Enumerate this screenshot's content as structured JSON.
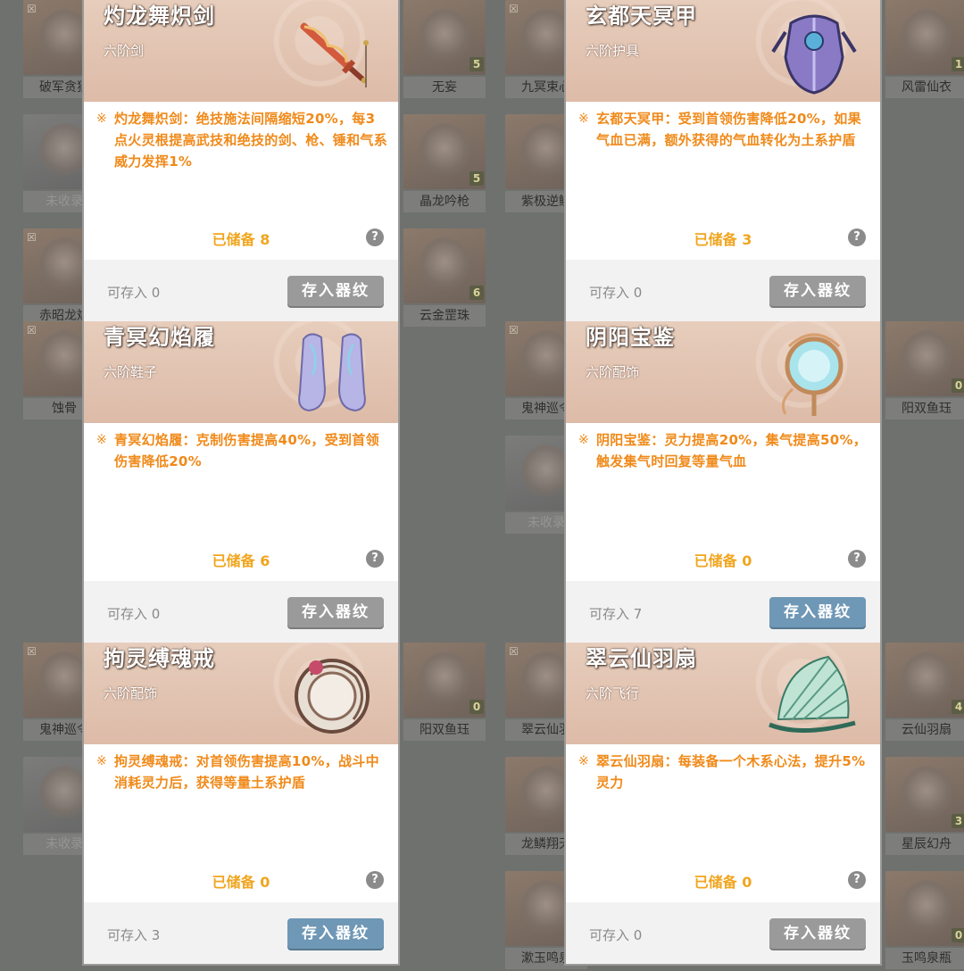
{
  "background_items": [
    {
      "label": "破军贪狼",
      "count": "",
      "tone": "warm",
      "locked": true
    },
    {
      "label": "无妄",
      "count": "5",
      "tone": "warm",
      "locked": false
    },
    {
      "label": "九冥束心",
      "count": "",
      "tone": "warm",
      "locked": true
    },
    {
      "label": "风雷仙衣",
      "count": "1",
      "tone": "warm",
      "locked": false
    },
    {
      "label": "未收录",
      "count": "",
      "tone": "gray",
      "locked": false
    },
    {
      "label": "晶龙吟枪",
      "count": "5",
      "tone": "warm",
      "locked": false
    },
    {
      "label": "紫极逆鳞",
      "count": "",
      "tone": "warm",
      "locked": false
    },
    {
      "label": "赤昭龙斌",
      "count": "",
      "tone": "warm",
      "locked": true
    },
    {
      "label": "云金罡珠",
      "count": "6",
      "tone": "warm",
      "locked": false
    },
    {
      "label": "蚀骨",
      "count": "",
      "tone": "warm",
      "locked": true
    },
    {
      "label": "鬼神巡令",
      "count": "",
      "tone": "warm",
      "locked": true
    },
    {
      "label": "阳双鱼珏",
      "count": "0",
      "tone": "warm",
      "locked": false
    },
    {
      "label": "未收录",
      "count": "",
      "tone": "gray",
      "locked": false
    },
    {
      "label": "鬼神巡令",
      "count": "",
      "tone": "warm",
      "locked": true
    },
    {
      "label": "阳双鱼珏",
      "count": "0",
      "tone": "warm",
      "locked": false
    },
    {
      "label": "翠云仙羽",
      "count": "",
      "tone": "warm",
      "locked": true
    },
    {
      "label": "云仙羽扇",
      "count": "4",
      "tone": "warm",
      "locked": false
    },
    {
      "label": "未收录",
      "count": "",
      "tone": "gray",
      "locked": false
    },
    {
      "label": "龙鳞翔天",
      "count": "",
      "tone": "warm",
      "locked": false
    },
    {
      "label": "星辰幻舟",
      "count": "3",
      "tone": "warm",
      "locked": false
    },
    {
      "label": "漱玉鸣泉",
      "count": "",
      "tone": "warm",
      "locked": false
    },
    {
      "label": "玉鸣泉瓶",
      "count": "0",
      "tone": "warm",
      "locked": false
    }
  ],
  "cards": [
    {
      "title": "灼龙舞炽剑",
      "type": "六阶剑",
      "art": "sword",
      "desc": "灼龙舞炽剑：绝技施法间隔缩短20%，每3点火灵根提高武技和绝技的剑、枪、锤和气系威力发挥1%",
      "stored": "已储备 8",
      "can_store": "可存入 0",
      "button": "存入器纹",
      "button_active": false
    },
    {
      "title": "青冥幻焰履",
      "type": "六阶鞋子",
      "art": "boots",
      "desc": "青冥幻焰履：克制伤害提高40%，受到首领伤害降低20%",
      "stored": "已储备 6",
      "can_store": "可存入 0",
      "button": "存入器纹",
      "button_active": false
    },
    {
      "title": "拘灵缚魂戒",
      "type": "六阶配饰",
      "art": "ring",
      "desc": "拘灵缚魂戒：对首领伤害提高10%，战斗中消耗灵力后，获得等量土系护盾",
      "stored": "已储备 0",
      "can_store": "可存入 3",
      "button": "存入器纹",
      "button_active": true
    },
    {
      "title": "玄都天冥甲",
      "type": "六阶护具",
      "art": "armor",
      "desc": "玄都天冥甲：受到首领伤害降低20%，如果气血已满，额外获得的气血转化为土系护盾",
      "stored": "已储备 3",
      "can_store": "可存入 0",
      "button": "存入器纹",
      "button_active": false
    },
    {
      "title": "阴阳宝鉴",
      "type": "六阶配饰",
      "art": "mirror",
      "desc": "阴阳宝鉴：灵力提高20%，集气提高50%，触发集气时回复等量气血",
      "stored": "已储备 0",
      "can_store": "可存入 7",
      "button": "存入器纹",
      "button_active": true
    },
    {
      "title": "翠云仙羽扇",
      "type": "六阶飞行",
      "art": "fan",
      "desc": "翠云仙羽扇：每装备一个木系心法，提升5%灵力",
      "stored": "已储备 0",
      "can_store": "可存入 0",
      "button": "存入器纹",
      "button_active": false
    }
  ],
  "help_glyph": "?",
  "bullet_glyph": "※",
  "lock_glyph": "☒",
  "colors": {
    "accent": "#f08a1a",
    "stored": "#f0a51e",
    "button_disabled": "#9a9a9a",
    "button_active": "#6f97b6",
    "header": "#e2c4b1"
  }
}
